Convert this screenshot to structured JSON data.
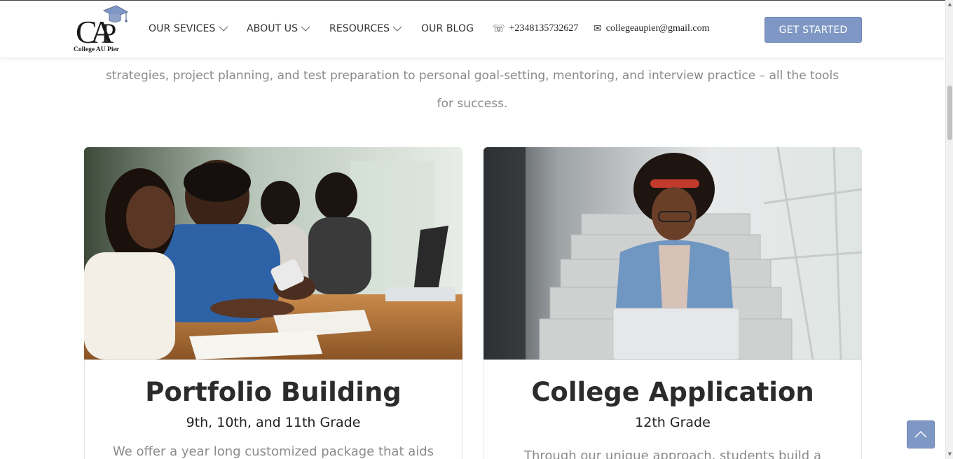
{
  "header": {
    "logo_letters": "CAP",
    "logo_text": "College AU Pier",
    "nav": [
      {
        "label": "OUR SEVICES",
        "has_dropdown": true
      },
      {
        "label": "ABOUT US",
        "has_dropdown": true
      },
      {
        "label": "RESOURCES",
        "has_dropdown": true
      },
      {
        "label": "OUR BLOG",
        "has_dropdown": false
      }
    ],
    "phone": "+2348135732627",
    "email": "collegeaupier@gmail.com",
    "cta_label": "GET STARTED"
  },
  "intro": {
    "line1": "strategies, project planning, and test preparation to personal goal-setting, mentoring, and interview practice – all the tools",
    "line2": "for success."
  },
  "cards": [
    {
      "title": "Portfolio Building",
      "subtitle": "9th, 10th, and 11th Grade",
      "text": "We offer a year long customized package that aids"
    },
    {
      "title": "College Application",
      "subtitle": "12th Grade",
      "text": "Through our unique approach, students build a"
    }
  ],
  "icons": {
    "phone": "phone-icon",
    "email": "envelope-icon",
    "back_to_top": "chevron-up-icon"
  },
  "colors": {
    "accent": "#7f97c4",
    "body_text": "#8a8a8a",
    "heading": "#2b2b2b"
  }
}
